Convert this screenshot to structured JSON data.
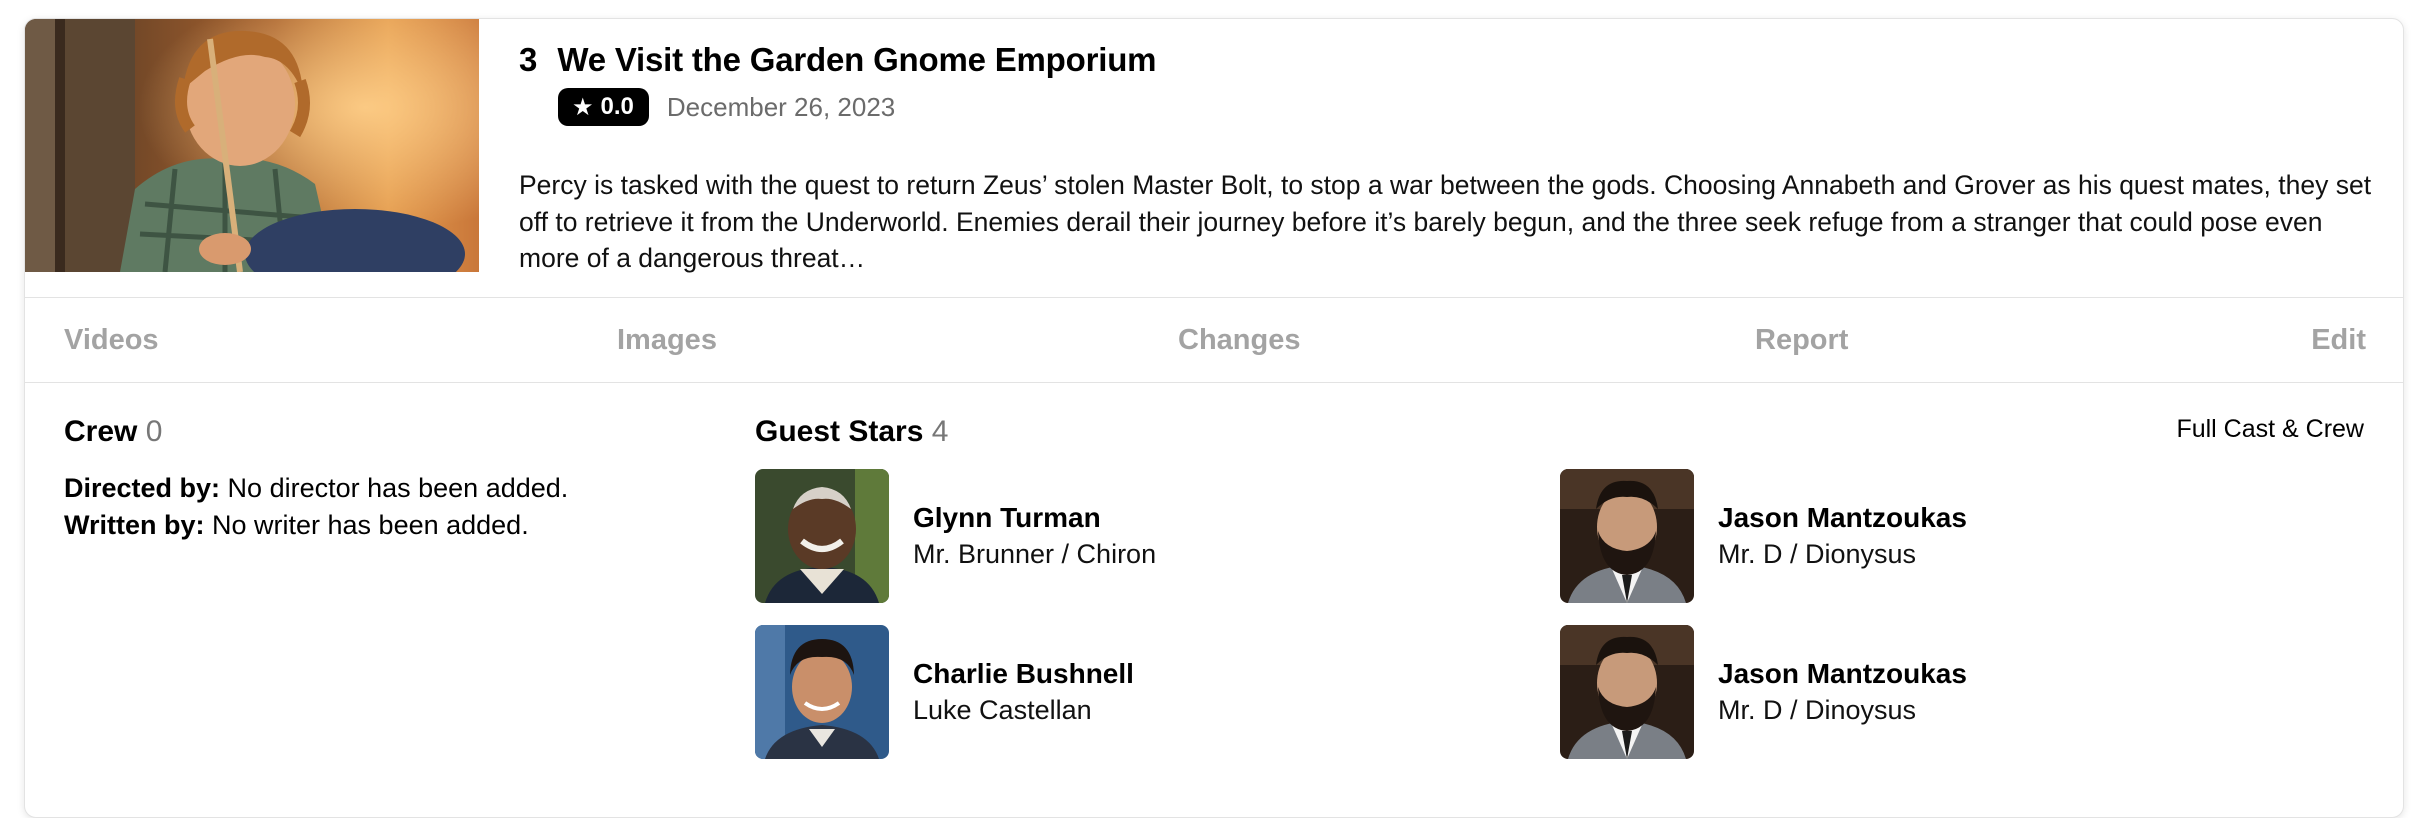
{
  "episode": {
    "number": "3",
    "title": "We Visit the Garden Gnome Emporium",
    "rating": "0.0",
    "rating_icon": "star-icon",
    "air_date": "December 26, 2023",
    "overview": "Percy is tasked with the quest to return Zeus’ stolen Master Bolt, to stop a war between the gods. Choosing Annabeth and Grover as his quest mates, they set off to retrieve it from the Underworld. Enemies derail their journey before it’s barely begun, and the three seek refuge from a stranger that could pose even more of a dangerous threat…"
  },
  "tabs": [
    "Videos",
    "Images",
    "Changes",
    "Report",
    "Edit"
  ],
  "crew": {
    "title": "Crew",
    "count": "0",
    "directed_label": "Directed by:",
    "directed_value": " No director has been added.",
    "written_label": "Written by:",
    "written_value": " No writer has been added."
  },
  "guest_stars": {
    "title": "Guest Stars",
    "count": "4",
    "full_cast_link": "Full Cast & Crew",
    "people": [
      {
        "name": "Glynn Turman",
        "role": "Mr. Brunner / Chiron"
      },
      {
        "name": "Jason Mantzoukas",
        "role": "Mr. D / Dionysus"
      },
      {
        "name": "Charlie Bushnell",
        "role": "Luke Castellan"
      },
      {
        "name": "Jason Mantzoukas",
        "role": "Mr. D / Dinoysus"
      }
    ]
  },
  "colors": {
    "badge_bg": "#000000",
    "tab_text": "#a3a3a3",
    "muted_text": "#6b6b6b",
    "border": "#e3e3e3"
  }
}
